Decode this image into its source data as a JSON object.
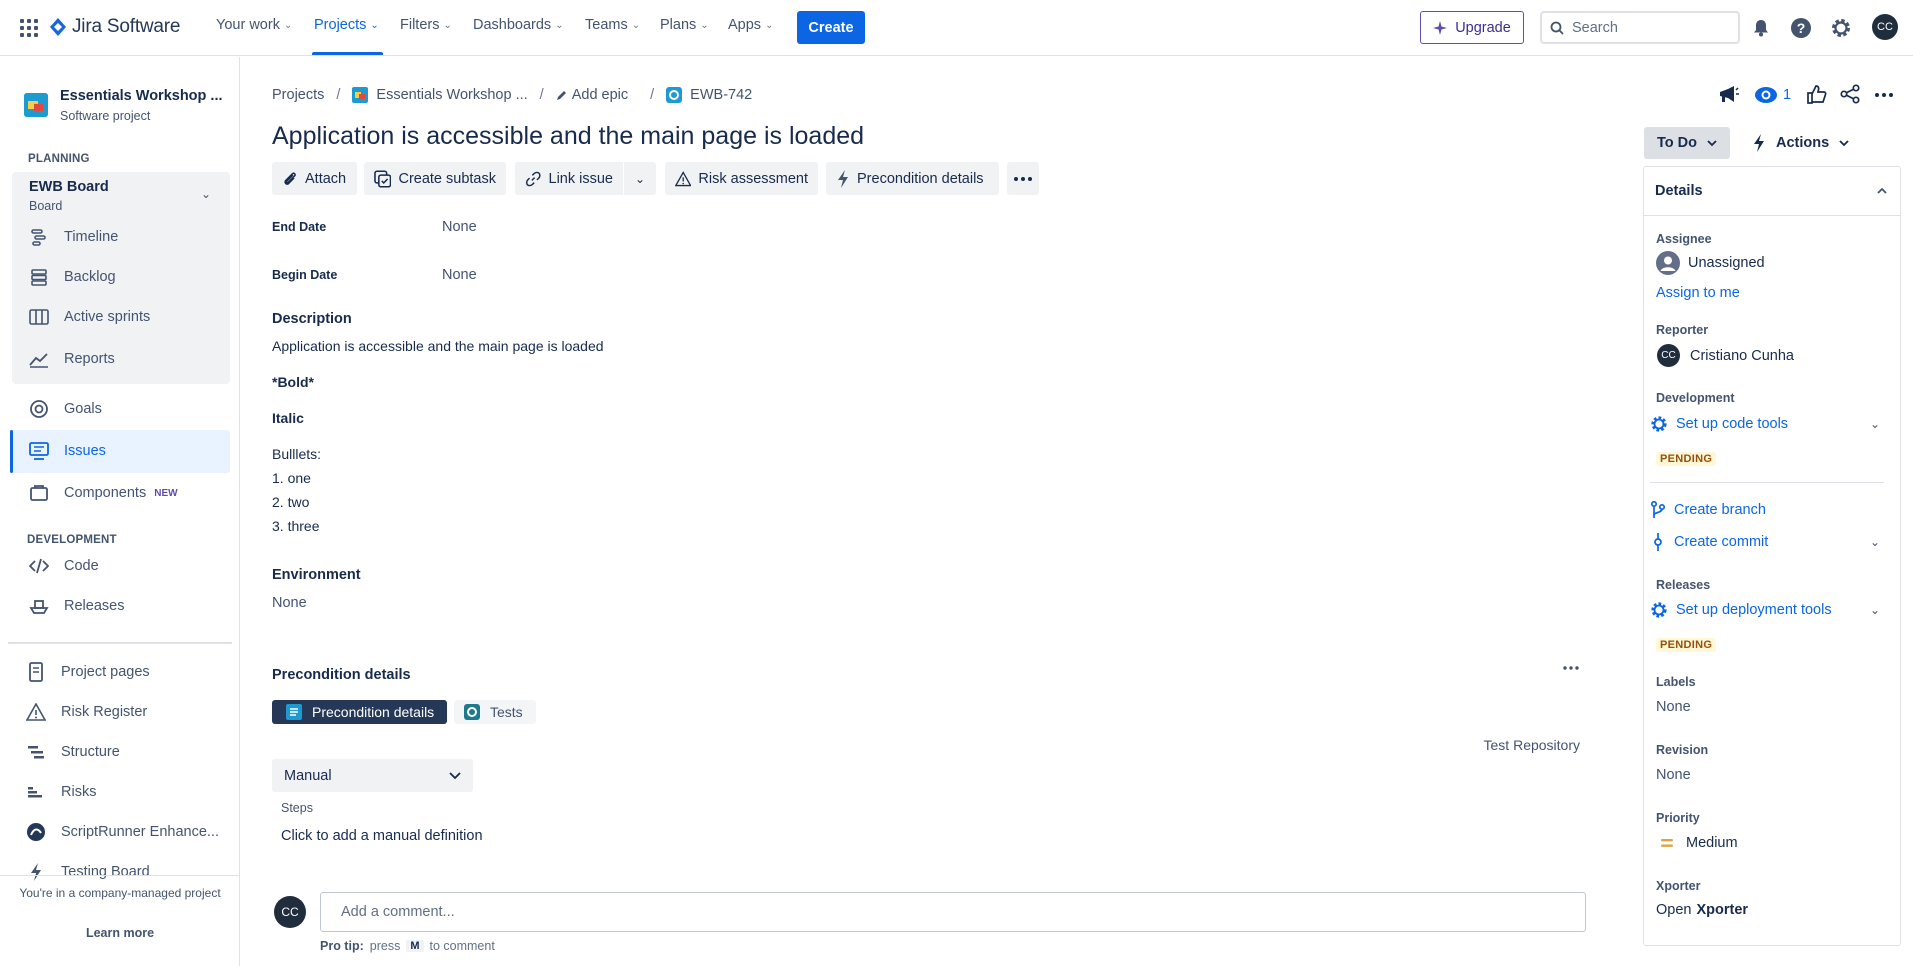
{
  "topnav": {
    "logo": "Jira Software",
    "items": [
      {
        "label": "Your work"
      },
      {
        "label": "Projects"
      },
      {
        "label": "Filters"
      },
      {
        "label": "Dashboards"
      },
      {
        "label": "Teams"
      },
      {
        "label": "Plans"
      },
      {
        "label": "Apps"
      }
    ],
    "create_label": "Create",
    "upgrade_label": "Upgrade",
    "search_placeholder": "Search",
    "avatar_initials": "CC",
    "accent": "#0c66e4"
  },
  "sidebar": {
    "project_name": "Essentials Workshop ...",
    "project_type": "Software project",
    "planning_head": "PLANNING",
    "board_name": "EWB Board",
    "board_sub": "Board",
    "planning_items": [
      {
        "label": "Timeline",
        "icon": "timeline-icon"
      },
      {
        "label": "Backlog",
        "icon": "backlog-icon"
      },
      {
        "label": "Active sprints",
        "icon": "board-columns-icon"
      },
      {
        "label": "Reports",
        "icon": "chart-line-icon"
      }
    ],
    "goals_label": "Goals",
    "issues_label": "Issues",
    "components_label": "Components",
    "new_badge": "NEW",
    "development_head": "DEVELOPMENT",
    "code_label": "Code",
    "releases_label": "Releases",
    "extra_items": [
      {
        "label": "Project pages"
      },
      {
        "label": "Risk Register"
      },
      {
        "label": "Structure"
      },
      {
        "label": "Risks"
      },
      {
        "label": "ScriptRunner Enhance..."
      },
      {
        "label": "Testing Board"
      }
    ],
    "company_note": "You're in a company-managed project",
    "learn_more": "Learn more"
  },
  "main": {
    "breadcrumb": {
      "projects": "Projects",
      "project": "Essentials Workshop ...",
      "add_epic": "Add epic",
      "issue_key": "EWB-742"
    },
    "title": "Application is accessible and the main page is loaded",
    "toolbar": {
      "attach": "Attach",
      "create_subtask": "Create subtask",
      "link_issue": "Link issue",
      "risk_assessment": "Risk assessment",
      "precondition_details": "Precondition details"
    },
    "fields": {
      "end_date_label": "End Date",
      "end_date_value": "None",
      "begin_date_label": "Begin Date",
      "begin_date_value": "None"
    },
    "description": {
      "label": "Description",
      "line1": "Application is accessible and the main page is loaded",
      "bold": "*Bold*",
      "italic": "Italic",
      "bullets_label": "Bulllets:",
      "items": [
        "1. one",
        "2. two",
        "3. three"
      ]
    },
    "environment": {
      "label": "Environment",
      "value": "None"
    },
    "precondition": {
      "title": "Precondition details",
      "tab_active": "Precondition details",
      "tab_tests": "Tests",
      "test_repository": "Test Repository",
      "type_value": "Manual",
      "steps_label": "Steps",
      "manual_hint": "Click to add a manual definition"
    },
    "comment": {
      "avatar_initials": "CC",
      "placeholder": "Add a comment...",
      "pro_tip_label": "Pro tip:",
      "pro_tip_press": "press",
      "pro_tip_key": "M",
      "pro_tip_suffix": "to comment"
    }
  },
  "right": {
    "watch_count": "1",
    "status": "To Do",
    "actions": "Actions",
    "details_title": "Details",
    "assignee_label": "Assignee",
    "assignee_value": "Unassigned",
    "assign_to_me": "Assign to me",
    "reporter_label": "Reporter",
    "reporter_initials": "CC",
    "reporter_value": "Cristiano Cunha",
    "development_label": "Development",
    "setup_code_tools": "Set up code tools",
    "pending": "PENDING",
    "create_branch": "Create branch",
    "create_commit": "Create commit",
    "releases_label": "Releases",
    "setup_deployment_tools": "Set up deployment tools",
    "labels_label": "Labels",
    "labels_value": "None",
    "revision_label": "Revision",
    "revision_value": "None",
    "priority_label": "Priority",
    "priority_value": "Medium",
    "xporter_label": "Xporter",
    "xporter_open": "Open",
    "xporter_name": "Xporter"
  }
}
